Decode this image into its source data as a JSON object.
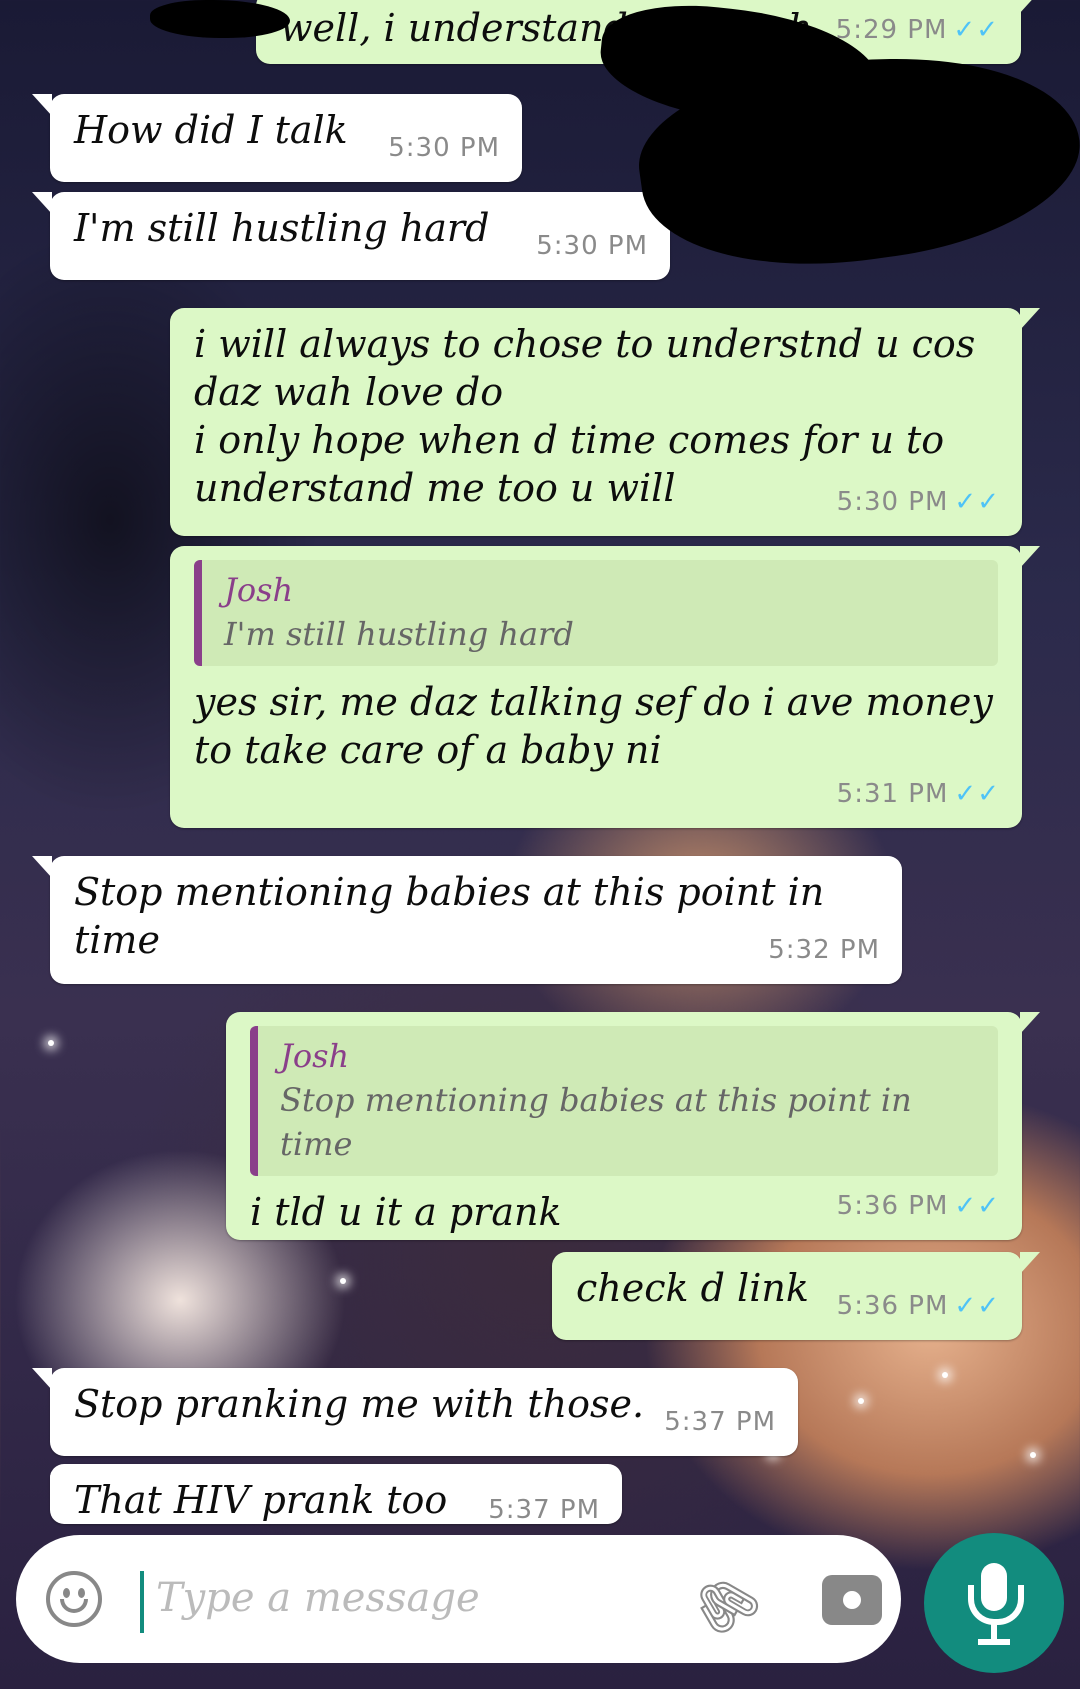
{
  "messages": [
    {
      "dir": "out",
      "text": "well, i understand u though",
      "time": "5:29 PM",
      "ticks": "✓✓"
    },
    {
      "dir": "in",
      "text": "How did I talk",
      "time": "5:30 PM"
    },
    {
      "dir": "in",
      "text": "I'm still hustling hard",
      "time": "5:30 PM"
    },
    {
      "dir": "out",
      "text": "i will always to chose to understnd u cos\ndaz wah love do\ni only hope when d time comes for u to\nunderstand me too u will",
      "time": "5:30 PM",
      "ticks": "✓✓"
    },
    {
      "dir": "out",
      "quote": {
        "author": "Josh",
        "text": "I'm still hustling hard"
      },
      "text": "yes sir, me daz talking sef do i ave money\nto take care of a baby ni",
      "time": "5:31 PM",
      "ticks": "✓✓"
    },
    {
      "dir": "in",
      "text": "Stop mentioning babies at this point in\ntime",
      "time": "5:32 PM"
    },
    {
      "dir": "out",
      "quote": {
        "author": "Josh",
        "text": "Stop mentioning babies at this point in time"
      },
      "text": "i tld u it a prank",
      "time": "5:36 PM",
      "ticks": "✓✓"
    },
    {
      "dir": "out",
      "text": "check d link",
      "time": "5:36 PM",
      "ticks": "✓✓"
    },
    {
      "dir": "in",
      "text": "Stop pranking me with those.",
      "time": "5:37 PM"
    },
    {
      "dir": "in",
      "text": "That HIV prank too",
      "time": "5:37 PM"
    }
  ],
  "input": {
    "placeholder": "Type a message"
  },
  "icons": {
    "emoji": "emoji-icon",
    "attach": "paperclip-icon",
    "camera": "camera-icon",
    "mic": "microphone-icon"
  },
  "colors": {
    "outgoing": "#dcf8c6",
    "incoming": "#ffffff",
    "accent": "#128c7e",
    "quote_bar": "#8a3f8a",
    "ticks": "#4fc3f7"
  }
}
